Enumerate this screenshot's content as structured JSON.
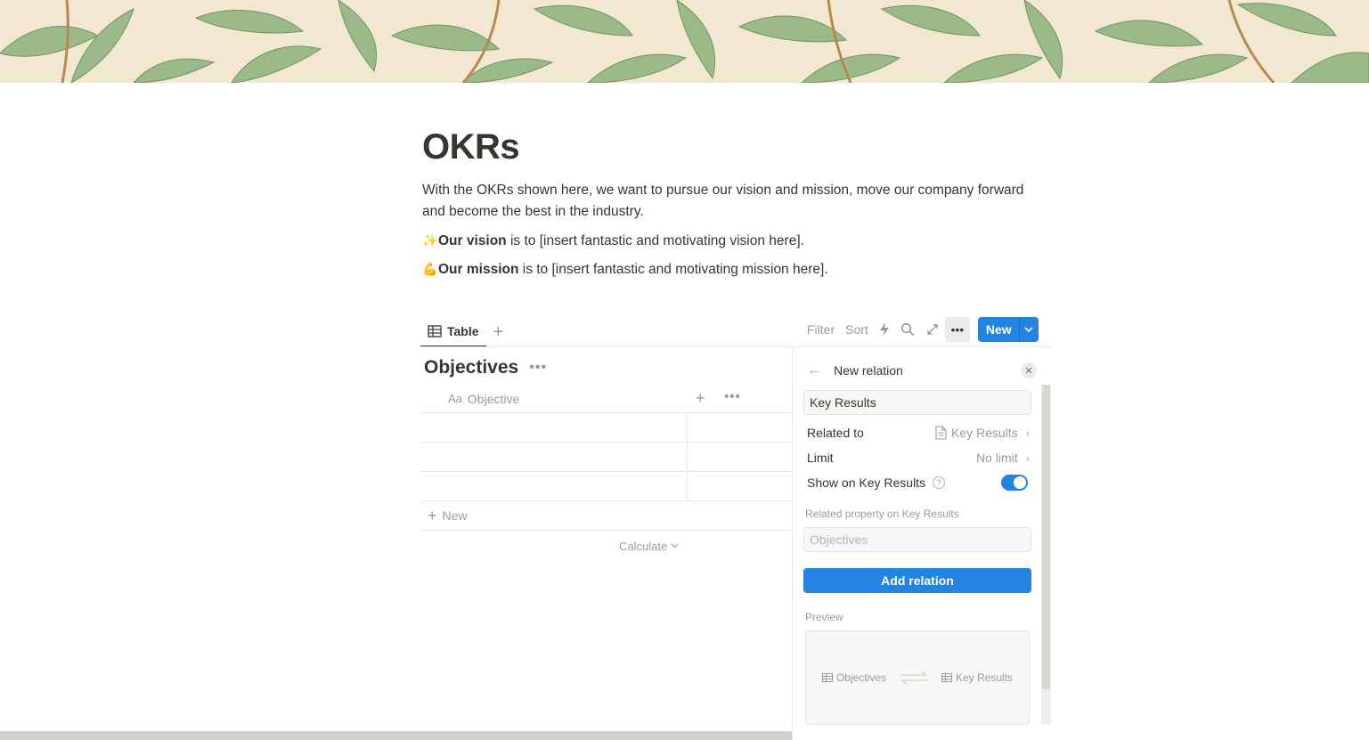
{
  "page": {
    "title": "OKRs",
    "intro": "With the OKRs shown here, we want to pursue our vision and mission, move our company forward and become the best in the industry.",
    "vision": {
      "emoji": "✨",
      "bold": "Our vision",
      "rest": " is to [insert fantastic and motivating vision here]."
    },
    "mission": {
      "emoji": "💪",
      "bold": "Our mission",
      "rest": " is to [insert fantastic and motivating mission here]."
    }
  },
  "toolbar": {
    "view_tab": "Table",
    "filter": "Filter",
    "sort": "Sort",
    "new": "New"
  },
  "database": {
    "title": "Objectives",
    "column_objective": "Objective",
    "column_icon": "Aa",
    "add_row": "New",
    "calculate": "Calculate"
  },
  "panel": {
    "title": "New relation",
    "name_value": "Key Results",
    "related_to_label": "Related to",
    "related_to_value": "Key Results",
    "limit_label": "Limit",
    "limit_value": "No limit",
    "show_on_label": "Show on Key Results",
    "show_on_enabled": true,
    "related_property_label": "Related property on Key Results",
    "related_property_placeholder": "Objectives",
    "add_button": "Add relation",
    "preview_label": "Preview",
    "preview_left": "Objectives",
    "preview_right": "Key Results"
  },
  "colors": {
    "accent": "#2383e2",
    "text": "#37352f",
    "muted": "#9b9a97"
  }
}
